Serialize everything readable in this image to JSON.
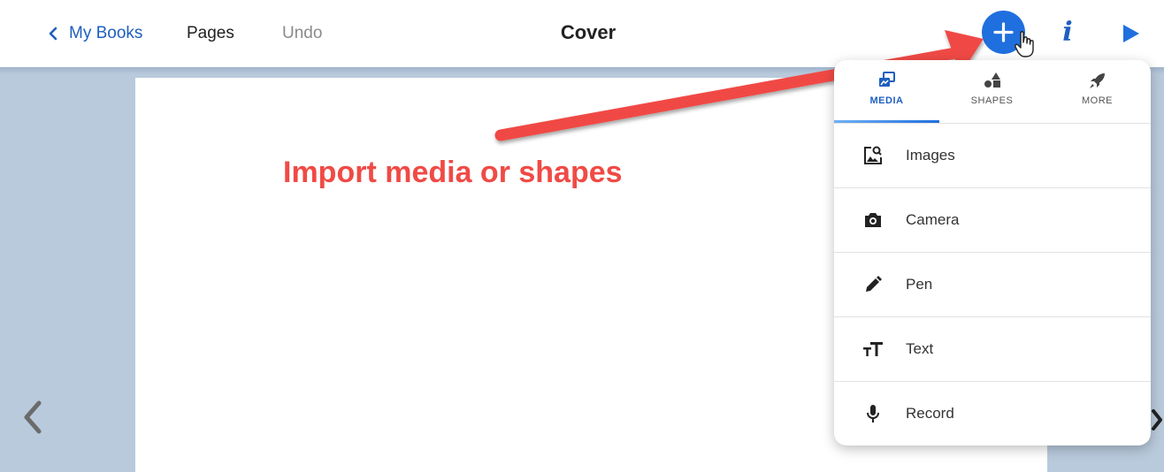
{
  "header": {
    "back_label": "My Books",
    "pages_label": "Pages",
    "undo_label": "Undo",
    "title": "Cover",
    "info_label": "i"
  },
  "annotation": {
    "callout_text": "Import media or shapes"
  },
  "menu": {
    "tabs": [
      {
        "label": "MEDIA",
        "icon": "media-icon",
        "active": true
      },
      {
        "label": "SHAPES",
        "icon": "shapes-icon",
        "active": false
      },
      {
        "label": "MORE",
        "icon": "rocket-icon",
        "active": false
      }
    ],
    "items": [
      {
        "label": "Images",
        "icon": "image-search-icon"
      },
      {
        "label": "Camera",
        "icon": "camera-icon"
      },
      {
        "label": "Pen",
        "icon": "pen-icon"
      },
      {
        "label": "Text",
        "icon": "text-size-icon"
      },
      {
        "label": "Record",
        "icon": "microphone-icon"
      }
    ]
  },
  "colors": {
    "accent": "#1f6fde",
    "link": "#1f5fbf",
    "callout": "#f04a45",
    "workspace": "#b9cadc"
  }
}
